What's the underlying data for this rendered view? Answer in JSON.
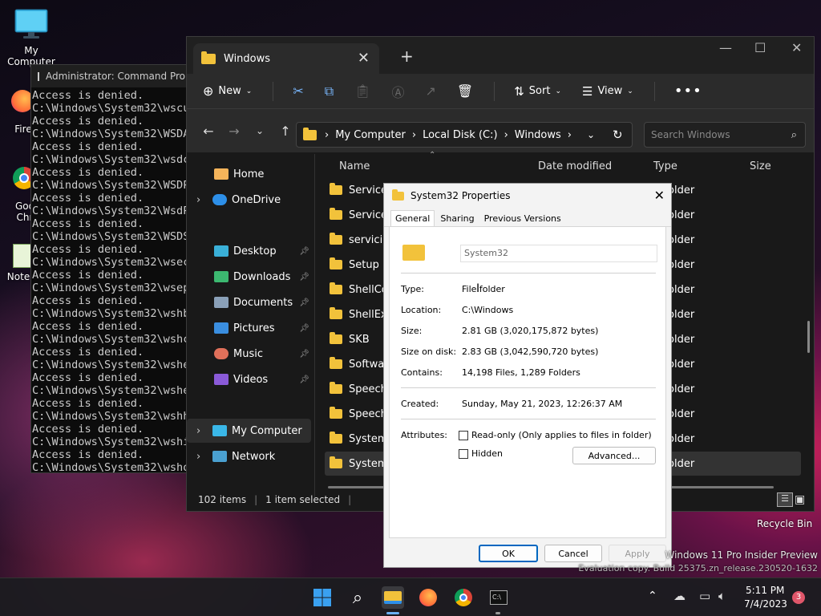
{
  "desktop": {
    "icons": [
      {
        "label": "My Computer"
      },
      {
        "label": "Fire"
      },
      {
        "label": "Goo\nChr"
      },
      {
        "label": "Note"
      }
    ],
    "recycle_bin": "Recycle Bin",
    "watermark_line1": "Windows 11 Pro Insider Preview",
    "watermark_line2": "Evaluation copy. Build 25375.zn_release.230520-1632"
  },
  "cmd": {
    "title": "Administrator: Command Prom",
    "lines": [
      "Access is denied.",
      "C:\\Windows\\System32\\wscu",
      "Access is denied.",
      "C:\\Windows\\System32\\WSDA",
      "Access is denied.",
      "C:\\Windows\\System32\\wsdc",
      "Access is denied.",
      "C:\\Windows\\System32\\WSDP",
      "Access is denied.",
      "C:\\Windows\\System32\\WsdP",
      "Access is denied.",
      "C:\\Windows\\System32\\WSDS",
      "Access is denied.",
      "C:\\Windows\\System32\\wsec",
      "Access is denied.",
      "C:\\Windows\\System32\\wsep",
      "Access is denied.",
      "C:\\Windows\\System32\\wshb",
      "Access is denied.",
      "C:\\Windows\\System32\\wshc",
      "Access is denied.",
      "C:\\Windows\\System32\\wshe",
      "Access is denied.",
      "C:\\Windows\\System32\\wshe",
      "Access is denied.",
      "C:\\Windows\\System32\\wshh",
      "Access is denied.",
      "C:\\Windows\\System32\\wshi",
      "Access is denied.",
      "C:\\Windows\\System32\\wsho"
    ]
  },
  "explorer": {
    "tab_title": "Windows",
    "toolbar": {
      "new": "New",
      "sort": "Sort",
      "view": "View"
    },
    "breadcrumb": [
      "My Computer",
      "Local Disk (C:)",
      "Windows"
    ],
    "search_placeholder": "Search Windows",
    "nav": {
      "home": "Home",
      "onedrive": "OneDrive",
      "desktop": "Desktop",
      "downloads": "Downloads",
      "documents": "Documents",
      "pictures": "Pictures",
      "music": "Music",
      "videos": "Videos",
      "mycomputer": "My Computer",
      "network": "Network"
    },
    "columns": {
      "name": "Name",
      "date": "Date modified",
      "type": "Type",
      "size": "Size"
    },
    "rows": [
      {
        "name": "ServicePr",
        "type": "older"
      },
      {
        "name": "ServiceSt",
        "type": "older"
      },
      {
        "name": "servicing",
        "type": "older"
      },
      {
        "name": "Setup",
        "type": "older"
      },
      {
        "name": "ShellCom",
        "type": "older"
      },
      {
        "name": "ShellExpe",
        "type": "older"
      },
      {
        "name": "SKB",
        "type": "older"
      },
      {
        "name": "Software",
        "type": "older"
      },
      {
        "name": "Speech",
        "type": "older"
      },
      {
        "name": "Speech_C",
        "type": "older"
      },
      {
        "name": "System",
        "type": "older"
      },
      {
        "name": "System32",
        "type": "older"
      }
    ],
    "status": {
      "items": "102 items",
      "selected": "1 item selected"
    }
  },
  "dialog": {
    "title": "System32 Properties",
    "tabs": [
      "General",
      "Sharing",
      "Previous Versions"
    ],
    "name_value": "System32",
    "labels": {
      "type": "Type:",
      "location": "Location:",
      "size": "Size:",
      "size_on_disk": "Size on disk:",
      "contains": "Contains:",
      "created": "Created:",
      "attributes": "Attributes:"
    },
    "values": {
      "type": "File folder",
      "location": "C:\\Windows",
      "size": "2.81 GB (3,020,175,872 bytes)",
      "size_on_disk": "2.83 GB (3,042,590,720 bytes)",
      "contains": "14,198 Files, 1,289 Folders",
      "created": "Sunday, May 21, 2023, 12:26:37 AM"
    },
    "readonly": "Read-only (Only applies to files in folder)",
    "hidden": "Hidden",
    "advanced": "Advanced...",
    "ok": "OK",
    "cancel": "Cancel",
    "apply": "Apply"
  },
  "taskbar": {
    "time": "5:11 PM",
    "date": "7/4/2023",
    "badge": "3"
  }
}
